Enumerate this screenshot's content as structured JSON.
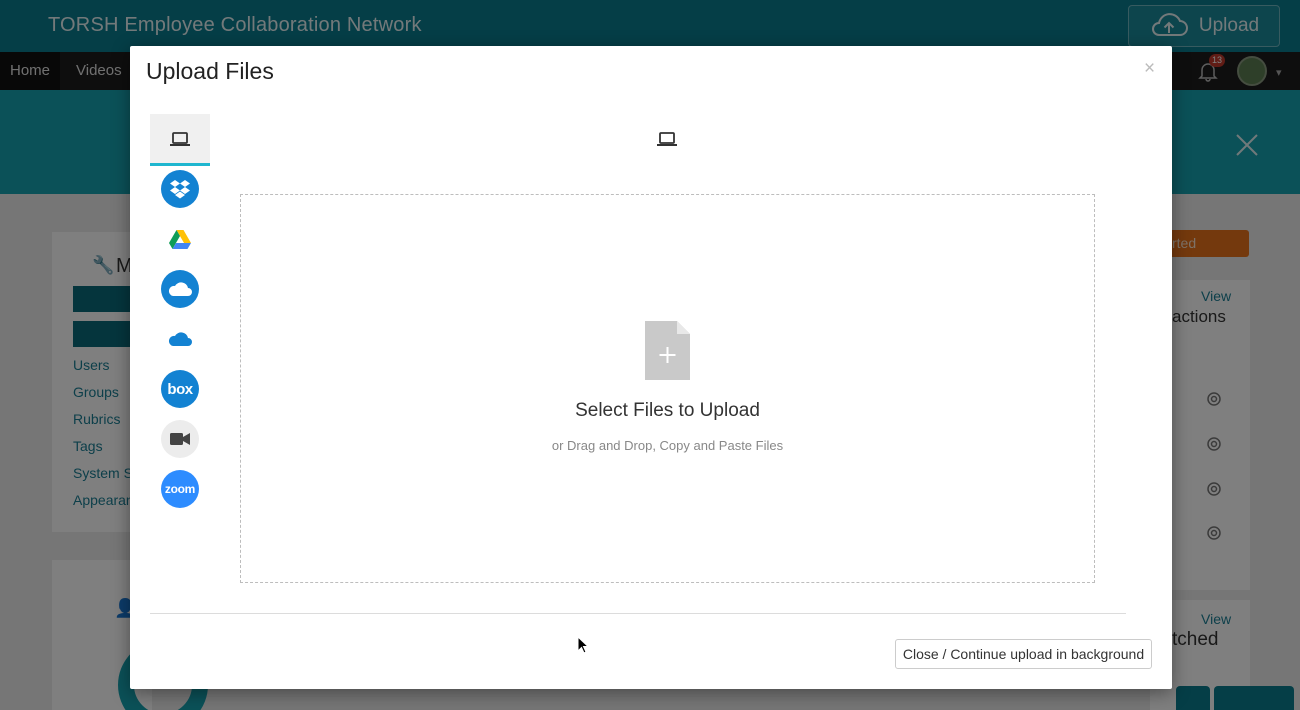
{
  "app": {
    "title": "TORSH Employee Collaboration Network",
    "upload_label": "Upload",
    "nav": {
      "home": "Home",
      "videos": "Videos"
    },
    "notification_count": "13"
  },
  "background": {
    "panel_heading_letter": "M",
    "side_links": [
      "Users",
      "Groups",
      "Rubrics",
      "Tags",
      "System Se",
      "Appearan"
    ],
    "status_pill": "rted",
    "view_label_1": "View",
    "actions_heading": "actions",
    "view_label_2": "View",
    "watched_heading": "tched"
  },
  "modal": {
    "title": "Upload Files",
    "close_glyph": "×",
    "sources": [
      {
        "name": "my-device",
        "icon": "laptop-icon",
        "active": true
      },
      {
        "name": "dropbox",
        "icon": "dropbox-icon"
      },
      {
        "name": "google-drive",
        "icon": "google-drive-icon"
      },
      {
        "name": "onedrive",
        "icon": "onedrive-icon"
      },
      {
        "name": "onedrive-business",
        "icon": "onedrive-business-icon"
      },
      {
        "name": "box",
        "icon": "box-icon",
        "label": "box"
      },
      {
        "name": "webcam",
        "icon": "video-camera-icon"
      },
      {
        "name": "zoom",
        "icon": "zoom-icon",
        "label": "zoom"
      }
    ],
    "drop_title": "Select Files to Upload",
    "drop_subtitle": "or Drag and Drop, Copy and Paste Files",
    "footer_button": "Close / Continue upload in background"
  },
  "colors": {
    "header_teal": "#0b7d8f",
    "band_teal": "#17a2b0",
    "active_underline": "#1fb6cf",
    "dropbox_blue": "#1382d2",
    "zoom_blue": "#2d8cff"
  }
}
